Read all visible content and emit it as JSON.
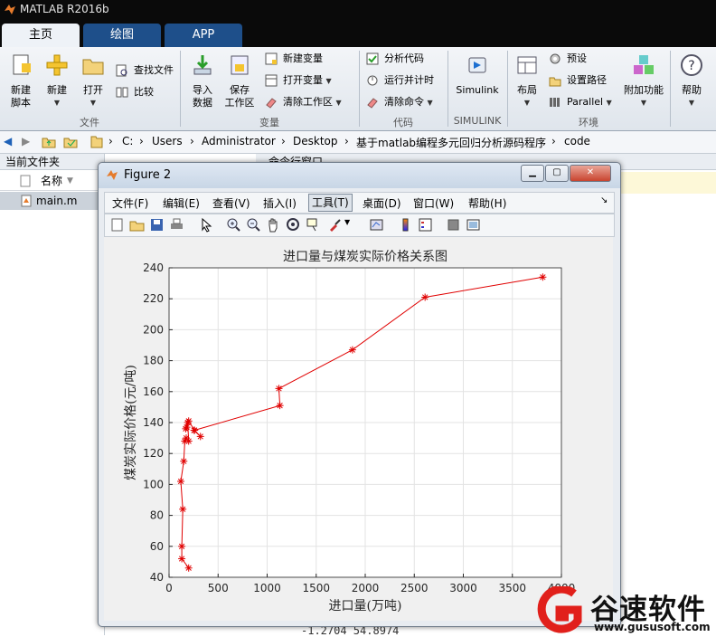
{
  "app": {
    "title": "MATLAB R2016b"
  },
  "tabs": [
    {
      "label": "主页",
      "active": true
    },
    {
      "label": "绘图",
      "active": false
    },
    {
      "label": "APP",
      "active": false
    }
  ],
  "ribbon": {
    "file": {
      "new_script": "新建\n脚本",
      "new": "新建",
      "open": "打开",
      "find_files": "查找文件",
      "compare": "比较",
      "section": "文件"
    },
    "variable": {
      "import": "导入\n数据",
      "save_ws": "保存\n工作区",
      "new_var": "新建变量",
      "open_var": "打开变量",
      "clear_ws": "清除工作区",
      "section": "变量"
    },
    "code": {
      "analyze": "分析代码",
      "run_time": "运行并计时",
      "clear_cmd": "清除命令",
      "section": "代码"
    },
    "simulink": {
      "label": "Simulink",
      "section": "SIMULINK"
    },
    "env": {
      "layout": "布局",
      "prefs": "预设",
      "set_path": "设置路径",
      "parallel": "Parallel",
      "addons": "附加功能",
      "section": "环境"
    },
    "resources": {
      "help": "帮助"
    }
  },
  "address": {
    "segments": [
      "C:",
      "Users",
      "Administrator",
      "Desktop",
      "基于matlab编程多元回归分析源码程序",
      "code"
    ]
  },
  "left_panel": {
    "title": "当前文件夹",
    "column": "名称",
    "files": [
      "main.m"
    ]
  },
  "command_panel": {
    "title": "命令行窗口",
    "bottom_text": "-1.2704  54.8974"
  },
  "figure": {
    "title": "Figure 2",
    "menus": [
      {
        "label": "文件(F)",
        "active": false
      },
      {
        "label": "编辑(E)",
        "active": false
      },
      {
        "label": "查看(V)",
        "active": false
      },
      {
        "label": "插入(I)",
        "active": false
      },
      {
        "label": "工具(T)",
        "active": true
      },
      {
        "label": "桌面(D)",
        "active": false
      },
      {
        "label": "窗口(W)",
        "active": false
      },
      {
        "label": "帮助(H)",
        "active": false
      }
    ]
  },
  "chart_data": {
    "type": "line",
    "title": "进口量与煤炭实际价格关系图",
    "xlabel": "进口量(万吨)",
    "ylabel": "煤炭实际价格(元/吨)",
    "xlim": [
      0,
      4000
    ],
    "ylim": [
      40,
      240
    ],
    "xticks": [
      0,
      500,
      1000,
      1500,
      2000,
      2500,
      3000,
      3500,
      4000
    ],
    "yticks": [
      40,
      60,
      80,
      100,
      120,
      140,
      160,
      180,
      200,
      220,
      240
    ],
    "grid": true,
    "marker": "*",
    "color": "#e00000",
    "x": [
      200,
      130,
      130,
      140,
      120,
      150,
      160,
      175,
      200,
      190,
      170,
      180,
      200,
      260,
      320,
      255,
      1130,
      1120,
      1870,
      2610,
      3810
    ],
    "y": [
      46,
      52,
      60,
      84,
      102,
      115,
      128,
      130,
      128,
      140,
      136,
      137,
      141,
      135,
      131,
      135,
      151,
      162,
      187,
      221,
      234
    ]
  },
  "watermark": {
    "name": "谷速软件",
    "url": "www.gususoft.com",
    "accent": "#e1201b"
  }
}
